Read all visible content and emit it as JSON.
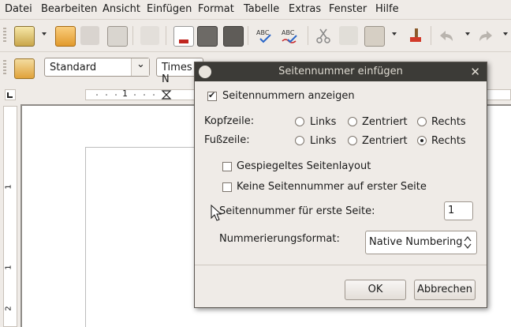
{
  "menu": [
    "Datei",
    "Bearbeiten",
    "Ansicht",
    "Einfügen",
    "Format",
    "Tabelle",
    "Extras",
    "Fenster",
    "Hilfe"
  ],
  "toolbar2": {
    "paragraph_style": "Standard",
    "font_name": "Times N"
  },
  "ruler": {
    "h_label": "1",
    "v_labels": [
      "1",
      "1",
      "2"
    ]
  },
  "dialog": {
    "title": "Seitennummer einfügen",
    "show_page_numbers": "Seitennummern anzeigen",
    "header_label": "Kopfzeile:",
    "footer_label": "Fußzeile:",
    "opt_left": "Links",
    "opt_center": "Zentriert",
    "opt_right": "Rechts",
    "mirrored_layout": "Gespiegeltes Seitenlayout",
    "no_number_first": "Keine Seitennummer auf erster Seite",
    "first_page_label": "Seitennummer für erste Seite:",
    "first_page_value": "1",
    "format_label": "Nummerierungsformat:",
    "format_value": "Native Numbering",
    "ok": "OK",
    "cancel": "Abbrechen"
  }
}
